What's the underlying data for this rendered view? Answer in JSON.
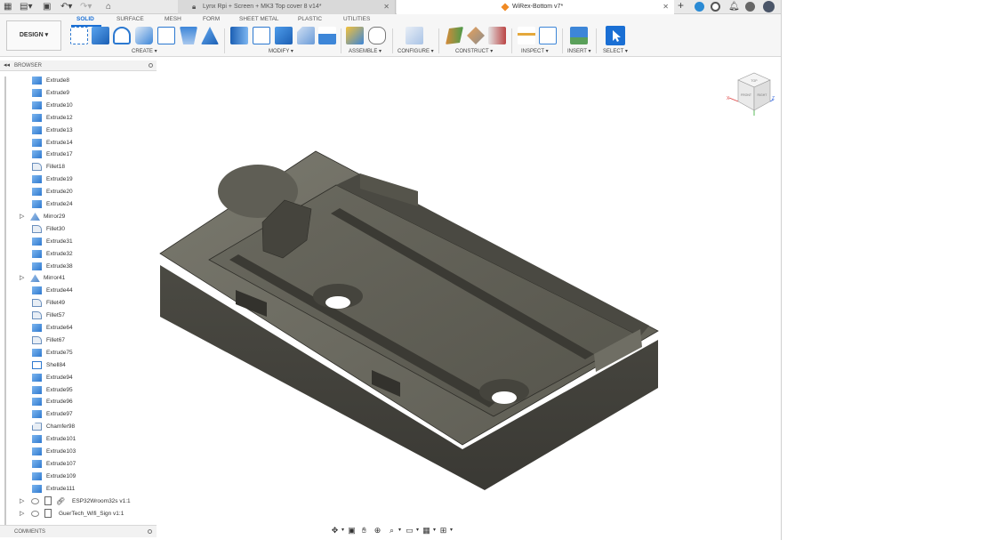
{
  "tabs": [
    {
      "title": "Lynx Rpi + Screen + MK3 Top cover 8 v14*",
      "active": false
    },
    {
      "title": "WiRex-Bottom v7*",
      "active": true
    }
  ],
  "ribbon": {
    "workspace": "DESIGN",
    "tabs": [
      "SOLID",
      "SURFACE",
      "MESH",
      "FORM",
      "SHEET METAL",
      "PLASTIC",
      "UTILITIES"
    ],
    "active_tab": "SOLID",
    "groups": [
      "CREATE",
      "MODIFY",
      "ASSEMBLE",
      "CONFIGURE",
      "CONSTRUCT",
      "INSPECT",
      "INSERT",
      "SELECT"
    ]
  },
  "browser": {
    "title": "BROWSER",
    "items": [
      {
        "label": "Extrude8",
        "icon": "extrude-icon"
      },
      {
        "label": "Extrude9",
        "icon": "extrude-icon"
      },
      {
        "label": "Extrude10",
        "icon": "extrude-icon"
      },
      {
        "label": "Extrude12",
        "icon": "extrude-icon"
      },
      {
        "label": "Extrude13",
        "icon": "extrude-icon"
      },
      {
        "label": "Extrude14",
        "icon": "extrude-icon"
      },
      {
        "label": "Extrude17",
        "icon": "extrude-icon"
      },
      {
        "label": "Fillet18",
        "icon": "fillet-icon"
      },
      {
        "label": "Extrude19",
        "icon": "extrude-icon"
      },
      {
        "label": "Extrude20",
        "icon": "extrude-icon"
      },
      {
        "label": "Extrude24",
        "icon": "extrude-icon"
      },
      {
        "label": "Mirror29",
        "icon": "mirror-icon",
        "expandable": true
      },
      {
        "label": "Fillet30",
        "icon": "fillet-icon"
      },
      {
        "label": "Extrude31",
        "icon": "extrude-icon"
      },
      {
        "label": "Extrude32",
        "icon": "extrude-icon"
      },
      {
        "label": "Extrude38",
        "icon": "extrude-icon"
      },
      {
        "label": "Mirror41",
        "icon": "mirror-icon",
        "expandable": true
      },
      {
        "label": "Extrude44",
        "icon": "extrude-icon"
      },
      {
        "label": "Fillet49",
        "icon": "fillet-icon"
      },
      {
        "label": "Fillet57",
        "icon": "fillet-icon"
      },
      {
        "label": "Extrude64",
        "icon": "extrude-icon"
      },
      {
        "label": "Fillet67",
        "icon": "fillet-icon"
      },
      {
        "label": "Extrude75",
        "icon": "extrude-icon"
      },
      {
        "label": "Shell84",
        "icon": "shell-icon"
      },
      {
        "label": "Extrude94",
        "icon": "extrude-icon"
      },
      {
        "label": "Extrude95",
        "icon": "extrude-icon"
      },
      {
        "label": "Extrude96",
        "icon": "extrude-icon"
      },
      {
        "label": "Extrude97",
        "icon": "extrude-icon"
      },
      {
        "label": "Chamfer98",
        "icon": "chamfer-icon"
      },
      {
        "label": "Extrude101",
        "icon": "extrude-icon"
      },
      {
        "label": "Extrude103",
        "icon": "extrude-icon"
      },
      {
        "label": "Extrude107",
        "icon": "extrude-icon"
      },
      {
        "label": "Extrude109",
        "icon": "extrude-icon"
      },
      {
        "label": "Extrude111",
        "icon": "extrude-icon"
      }
    ],
    "components": [
      {
        "label": "ESP32Wroom32s v1:1",
        "linked": true
      },
      {
        "label": "GuerTech_Wifi_Sign v1:1",
        "linked": false
      }
    ]
  },
  "comments": {
    "title": "COMMENTS"
  },
  "viewcube": {
    "top": "TOP",
    "front": "FRONT",
    "right": "RIGHT"
  },
  "colors": {
    "accent": "#1a6fd4",
    "model_face": "#6b6a60",
    "model_dark": "#3f3e37",
    "extrude_icon": "#3f86d6"
  }
}
